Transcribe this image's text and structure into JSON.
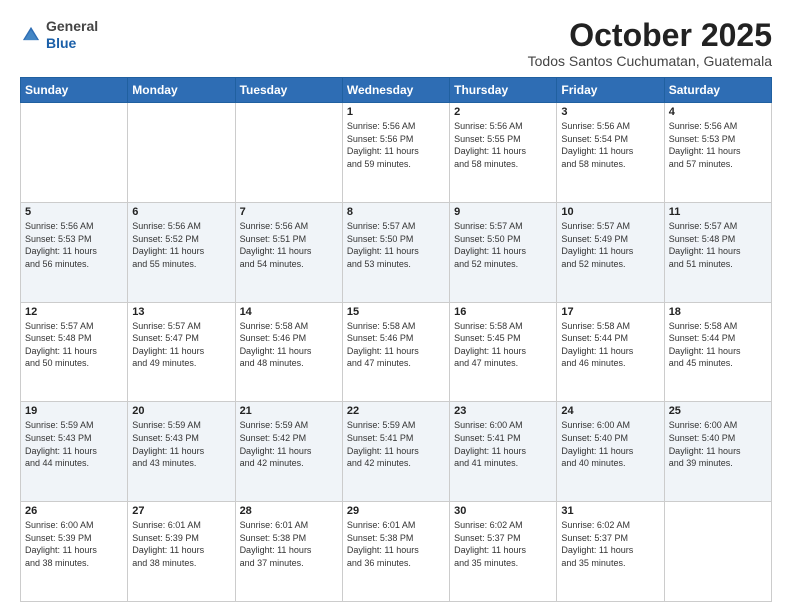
{
  "header": {
    "logo_general": "General",
    "logo_blue": "Blue",
    "title": "October 2025",
    "location": "Todos Santos Cuchumatan, Guatemala"
  },
  "weekdays": [
    "Sunday",
    "Monday",
    "Tuesday",
    "Wednesday",
    "Thursday",
    "Friday",
    "Saturday"
  ],
  "weeks": [
    [
      {
        "day": "",
        "info": ""
      },
      {
        "day": "",
        "info": ""
      },
      {
        "day": "",
        "info": ""
      },
      {
        "day": "1",
        "info": "Sunrise: 5:56 AM\nSunset: 5:56 PM\nDaylight: 11 hours\nand 59 minutes."
      },
      {
        "day": "2",
        "info": "Sunrise: 5:56 AM\nSunset: 5:55 PM\nDaylight: 11 hours\nand 58 minutes."
      },
      {
        "day": "3",
        "info": "Sunrise: 5:56 AM\nSunset: 5:54 PM\nDaylight: 11 hours\nand 58 minutes."
      },
      {
        "day": "4",
        "info": "Sunrise: 5:56 AM\nSunset: 5:53 PM\nDaylight: 11 hours\nand 57 minutes."
      }
    ],
    [
      {
        "day": "5",
        "info": "Sunrise: 5:56 AM\nSunset: 5:53 PM\nDaylight: 11 hours\nand 56 minutes."
      },
      {
        "day": "6",
        "info": "Sunrise: 5:56 AM\nSunset: 5:52 PM\nDaylight: 11 hours\nand 55 minutes."
      },
      {
        "day": "7",
        "info": "Sunrise: 5:56 AM\nSunset: 5:51 PM\nDaylight: 11 hours\nand 54 minutes."
      },
      {
        "day": "8",
        "info": "Sunrise: 5:57 AM\nSunset: 5:50 PM\nDaylight: 11 hours\nand 53 minutes."
      },
      {
        "day": "9",
        "info": "Sunrise: 5:57 AM\nSunset: 5:50 PM\nDaylight: 11 hours\nand 52 minutes."
      },
      {
        "day": "10",
        "info": "Sunrise: 5:57 AM\nSunset: 5:49 PM\nDaylight: 11 hours\nand 52 minutes."
      },
      {
        "day": "11",
        "info": "Sunrise: 5:57 AM\nSunset: 5:48 PM\nDaylight: 11 hours\nand 51 minutes."
      }
    ],
    [
      {
        "day": "12",
        "info": "Sunrise: 5:57 AM\nSunset: 5:48 PM\nDaylight: 11 hours\nand 50 minutes."
      },
      {
        "day": "13",
        "info": "Sunrise: 5:57 AM\nSunset: 5:47 PM\nDaylight: 11 hours\nand 49 minutes."
      },
      {
        "day": "14",
        "info": "Sunrise: 5:58 AM\nSunset: 5:46 PM\nDaylight: 11 hours\nand 48 minutes."
      },
      {
        "day": "15",
        "info": "Sunrise: 5:58 AM\nSunset: 5:46 PM\nDaylight: 11 hours\nand 47 minutes."
      },
      {
        "day": "16",
        "info": "Sunrise: 5:58 AM\nSunset: 5:45 PM\nDaylight: 11 hours\nand 47 minutes."
      },
      {
        "day": "17",
        "info": "Sunrise: 5:58 AM\nSunset: 5:44 PM\nDaylight: 11 hours\nand 46 minutes."
      },
      {
        "day": "18",
        "info": "Sunrise: 5:58 AM\nSunset: 5:44 PM\nDaylight: 11 hours\nand 45 minutes."
      }
    ],
    [
      {
        "day": "19",
        "info": "Sunrise: 5:59 AM\nSunset: 5:43 PM\nDaylight: 11 hours\nand 44 minutes."
      },
      {
        "day": "20",
        "info": "Sunrise: 5:59 AM\nSunset: 5:43 PM\nDaylight: 11 hours\nand 43 minutes."
      },
      {
        "day": "21",
        "info": "Sunrise: 5:59 AM\nSunset: 5:42 PM\nDaylight: 11 hours\nand 42 minutes."
      },
      {
        "day": "22",
        "info": "Sunrise: 5:59 AM\nSunset: 5:41 PM\nDaylight: 11 hours\nand 42 minutes."
      },
      {
        "day": "23",
        "info": "Sunrise: 6:00 AM\nSunset: 5:41 PM\nDaylight: 11 hours\nand 41 minutes."
      },
      {
        "day": "24",
        "info": "Sunrise: 6:00 AM\nSunset: 5:40 PM\nDaylight: 11 hours\nand 40 minutes."
      },
      {
        "day": "25",
        "info": "Sunrise: 6:00 AM\nSunset: 5:40 PM\nDaylight: 11 hours\nand 39 minutes."
      }
    ],
    [
      {
        "day": "26",
        "info": "Sunrise: 6:00 AM\nSunset: 5:39 PM\nDaylight: 11 hours\nand 38 minutes."
      },
      {
        "day": "27",
        "info": "Sunrise: 6:01 AM\nSunset: 5:39 PM\nDaylight: 11 hours\nand 38 minutes."
      },
      {
        "day": "28",
        "info": "Sunrise: 6:01 AM\nSunset: 5:38 PM\nDaylight: 11 hours\nand 37 minutes."
      },
      {
        "day": "29",
        "info": "Sunrise: 6:01 AM\nSunset: 5:38 PM\nDaylight: 11 hours\nand 36 minutes."
      },
      {
        "day": "30",
        "info": "Sunrise: 6:02 AM\nSunset: 5:37 PM\nDaylight: 11 hours\nand 35 minutes."
      },
      {
        "day": "31",
        "info": "Sunrise: 6:02 AM\nSunset: 5:37 PM\nDaylight: 11 hours\nand 35 minutes."
      },
      {
        "day": "",
        "info": ""
      }
    ]
  ]
}
